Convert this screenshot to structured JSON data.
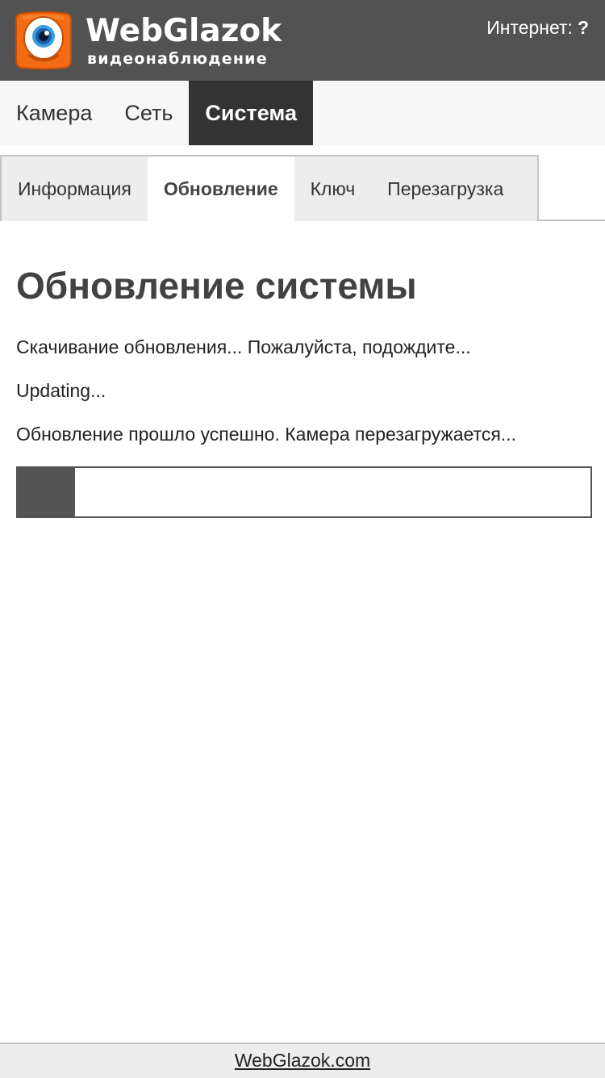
{
  "header": {
    "brand_name": "WebGlazok",
    "brand_subtitle": "видеонаблюдение",
    "logo_icon": "webglazok-eye-logo-icon",
    "internet_label": "Интернет:",
    "internet_value": "?"
  },
  "main_nav": {
    "items": [
      {
        "label": "Камера"
      },
      {
        "label": "Сеть"
      },
      {
        "label": "Система"
      }
    ],
    "active": "Система"
  },
  "sub_tabs": {
    "items": [
      {
        "label": "Информация"
      },
      {
        "label": "Обновление"
      },
      {
        "label": "Ключ"
      },
      {
        "label": "Перезагрузка"
      }
    ],
    "active": "Обновление"
  },
  "main": {
    "title": "Обновление системы",
    "messages": [
      "Скачивание обновления... Пожалуйста, подождите...",
      "Updating...",
      "Обновление прошло успешно. Камера перезагружается..."
    ],
    "progress_fraction": 0.1
  },
  "footer": {
    "link": "WebGlazok.com"
  },
  "colors": {
    "header_bg": "#525252",
    "logo_orange": "#f36b12",
    "active_nav_bg": "#333333",
    "progress_fill": "#555555"
  }
}
